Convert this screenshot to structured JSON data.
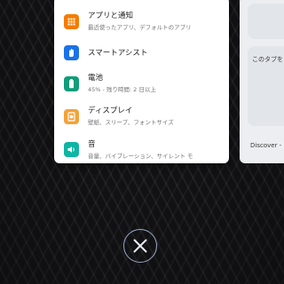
{
  "settings_card": {
    "items": [
      {
        "title": "アプリと通知",
        "subtitle": "最近使ったアプリ、デフォルトのアプリ",
        "icon": "apps-grid-icon",
        "color": "#f57c00"
      },
      {
        "title": "スマートアシスト",
        "subtitle": "",
        "icon": "hand-icon",
        "color": "#1a73e8"
      },
      {
        "title": "電池",
        "subtitle": "45% - 残り時間: 2 日以上",
        "icon": "battery-icon",
        "color": "#0f9d7a"
      },
      {
        "title": "ディスプレイ",
        "subtitle": "壁紙、スリープ、フォントサイズ",
        "icon": "brightness-icon",
        "color": "#f2a33a"
      },
      {
        "title": "音",
        "subtitle": "音量、バイブレーション、サイレント モ",
        "icon": "volume-icon",
        "color": "#0fb5a4"
      }
    ]
  },
  "right_card": {
    "text": "このタブを",
    "footer": "Discover -"
  },
  "close_button": {
    "icon": "close-icon",
    "color": "#9aa7c8"
  }
}
